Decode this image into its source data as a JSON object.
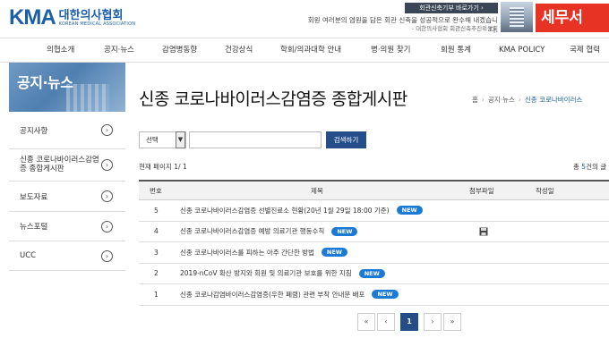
{
  "header": {
    "logo_mark": "KMA",
    "logo_ko": "대한의사협회",
    "logo_en": "KOREAN MEDICAL ASSOCIATION",
    "campaign_button": "회관신축기부 바로가기 ›",
    "campaign_text": "회원 여러분의 염원을 담은 회관 신축을 성공적으로 완수해 내겠습니다.",
    "campaign_sub": "- 대한의사협회 회관신축추진위원회",
    "tax_banner": "세무서"
  },
  "gnb": [
    "의협소개",
    "공지·뉴스",
    "감염병동향",
    "건강상식",
    "학회/의과대학 안내",
    "병·의원 찾기",
    "회원 통계",
    "KMA POLICY",
    "국제 협력"
  ],
  "sidebar": {
    "title": "공지·뉴스",
    "items": [
      {
        "label": "공지사항"
      },
      {
        "label": "신종 코로나바이러스감염증 종합게시판"
      },
      {
        "label": "보도자료"
      },
      {
        "label": "뉴스포털"
      },
      {
        "label": "UCC"
      }
    ]
  },
  "main": {
    "title": "신종 코로나바이러스감염증 종합게시판",
    "breadcrumb": [
      "홈",
      "공지·뉴스",
      "신종 코로나바이러스"
    ],
    "search": {
      "select_value": "선택",
      "input_value": "",
      "button": "검색하기"
    },
    "page_info": "현재 페이지 1/ 1",
    "total_info": {
      "prefix": "총 ",
      "count": "5",
      "suffix": "건의 글"
    }
  },
  "board": {
    "columns": {
      "no": "번호",
      "title": "제목",
      "attach": "첨부파일",
      "author": "작성일"
    },
    "new_badge": "NEW",
    "rows": [
      {
        "no": "5",
        "title": "신종 코로나바이러스감염증 선별진료소 현황(20년 1월 29일 18:00 기준)",
        "attach": false
      },
      {
        "no": "4",
        "title": "신종 코로나바이러스감염증 예방 의료기관 행동수칙",
        "attach": true
      },
      {
        "no": "3",
        "title": "신종 코로나바이러스를 피하는 아주 간단한 방법",
        "attach": false
      },
      {
        "no": "2",
        "title": "2019-nCoV 확산 방지와 회원 및 의료기관 보호를 위한 지침",
        "attach": false
      },
      {
        "no": "1",
        "title": "신종 코로나감염바이러스감염증(우한 폐렴) 관련 부착 안내문 배포",
        "attach": false
      }
    ]
  },
  "pager": {
    "first": "«",
    "prev": "‹",
    "current": "1",
    "next": "›",
    "last": "»"
  },
  "icons": {
    "arrow": "circle-arrow-right-icon",
    "attach": "floppy-disk-icon"
  },
  "colors": {
    "brand": "#1a5fa8",
    "button": "#254d8a",
    "new_badge": "#1a7ad6",
    "tax_banner": "#e63323"
  }
}
